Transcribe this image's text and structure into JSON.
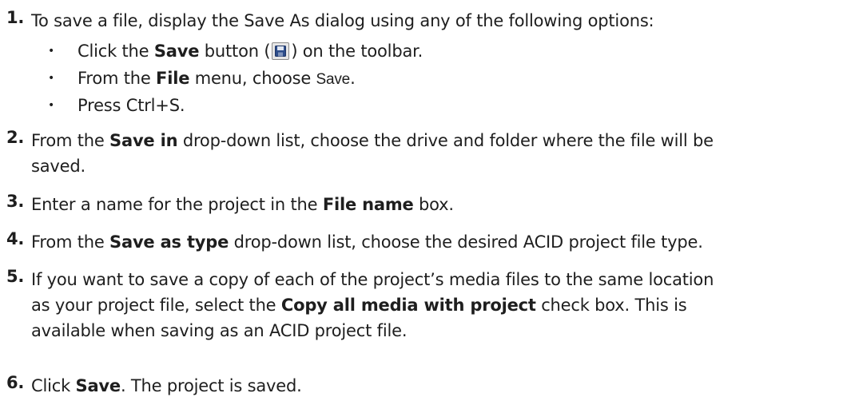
{
  "steps": [
    {
      "number": "1.",
      "lines": [
        [
          "To save a file, display the Save As dialog using any of the following options:"
        ]
      ],
      "bullets": [
        {
          "pre": "Click the ",
          "bold": "Save",
          "post_before_icon": " button (",
          "icon": "floppy-disk-icon",
          "post": ") on the toolbar."
        },
        {
          "pre": "From the ",
          "bold": "File",
          "mid": " menu, choose ",
          "mono": "Save",
          "post": "."
        },
        {
          "text": "Press Ctrl+S."
        }
      ]
    },
    {
      "number": "2.",
      "line1_pre": "From the ",
      "line1_bold": "Save in",
      "line1_post": " drop-down list, choose the drive and folder where the file will be",
      "line2": "saved."
    },
    {
      "number": "3.",
      "pre": "Enter a name for the project in the ",
      "bold": "File name",
      "post": " box."
    },
    {
      "number": "4.",
      "pre": "From the ",
      "bold": "Save as type",
      "post": " drop-down list, choose the desired ACID project file type."
    },
    {
      "number": "5.",
      "line1": "If you want to save a copy of each of the project’s media files to the same location",
      "line2_pre": "as your project file, select the ",
      "line2_bold": "Copy all media with project",
      "line2_post": " check box. This is",
      "line3": "available when saving as an ACID project file."
    },
    {
      "number": "6.",
      "pre": "Click ",
      "bold": "Save",
      "post": ". The project is saved."
    }
  ],
  "bullet_char": "•"
}
